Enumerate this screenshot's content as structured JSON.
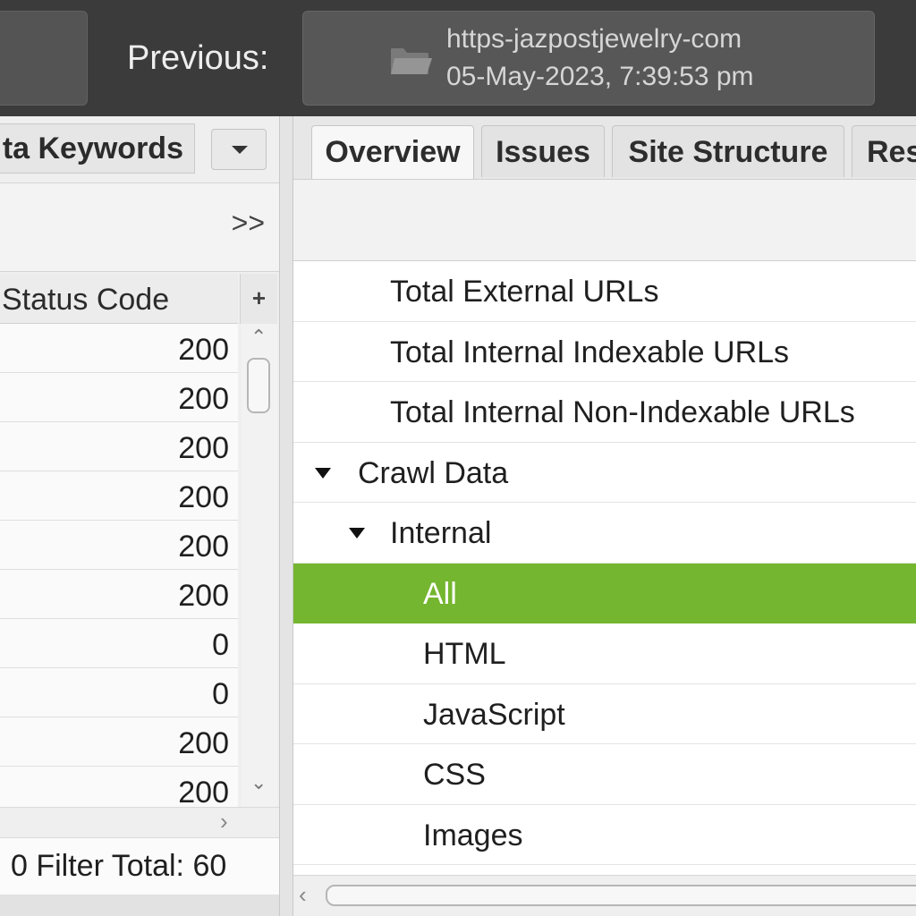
{
  "header": {
    "previous_label": "Previous:",
    "previous_crawl_name": "https-jazpostjewelry-com",
    "previous_crawl_date": "05-May-2023, 7:39:53 pm"
  },
  "left_panel": {
    "tab_label": "ta Keywords",
    "expand_label": ">>",
    "column_header": "Status Code",
    "add_column_label": "+",
    "status_codes": [
      "200",
      "200",
      "200",
      "200",
      "200",
      "200",
      "0",
      "0",
      "200",
      "200"
    ],
    "filter_text": "0  Filter Total:  60"
  },
  "right_panel": {
    "tabs": [
      {
        "label": "Overview",
        "active": true
      },
      {
        "label": "Issues",
        "active": false
      },
      {
        "label": "Site Structure",
        "active": false
      },
      {
        "label": "Res",
        "active": false
      }
    ],
    "tree": [
      {
        "label": "Total External URLs",
        "level": 2,
        "expanded": null,
        "selected": false
      },
      {
        "label": "Total Internal Indexable URLs",
        "level": 2,
        "expanded": null,
        "selected": false
      },
      {
        "label": "Total Internal Non-Indexable URLs",
        "level": 2,
        "expanded": null,
        "selected": false
      },
      {
        "label": "Crawl Data",
        "level": 0,
        "expanded": true,
        "selected": false
      },
      {
        "label": "Internal",
        "level": 1,
        "expanded": true,
        "selected": false
      },
      {
        "label": "All",
        "level": 3,
        "expanded": null,
        "selected": true
      },
      {
        "label": "HTML",
        "level": 3,
        "expanded": null,
        "selected": false
      },
      {
        "label": "JavaScript",
        "level": 3,
        "expanded": null,
        "selected": false
      },
      {
        "label": "CSS",
        "level": 3,
        "expanded": null,
        "selected": false
      },
      {
        "label": "Images",
        "level": 3,
        "expanded": null,
        "selected": false
      }
    ]
  },
  "colors": {
    "topbar": "#3b3b3b",
    "selection": "#74b62f",
    "panel": "#efefef"
  }
}
